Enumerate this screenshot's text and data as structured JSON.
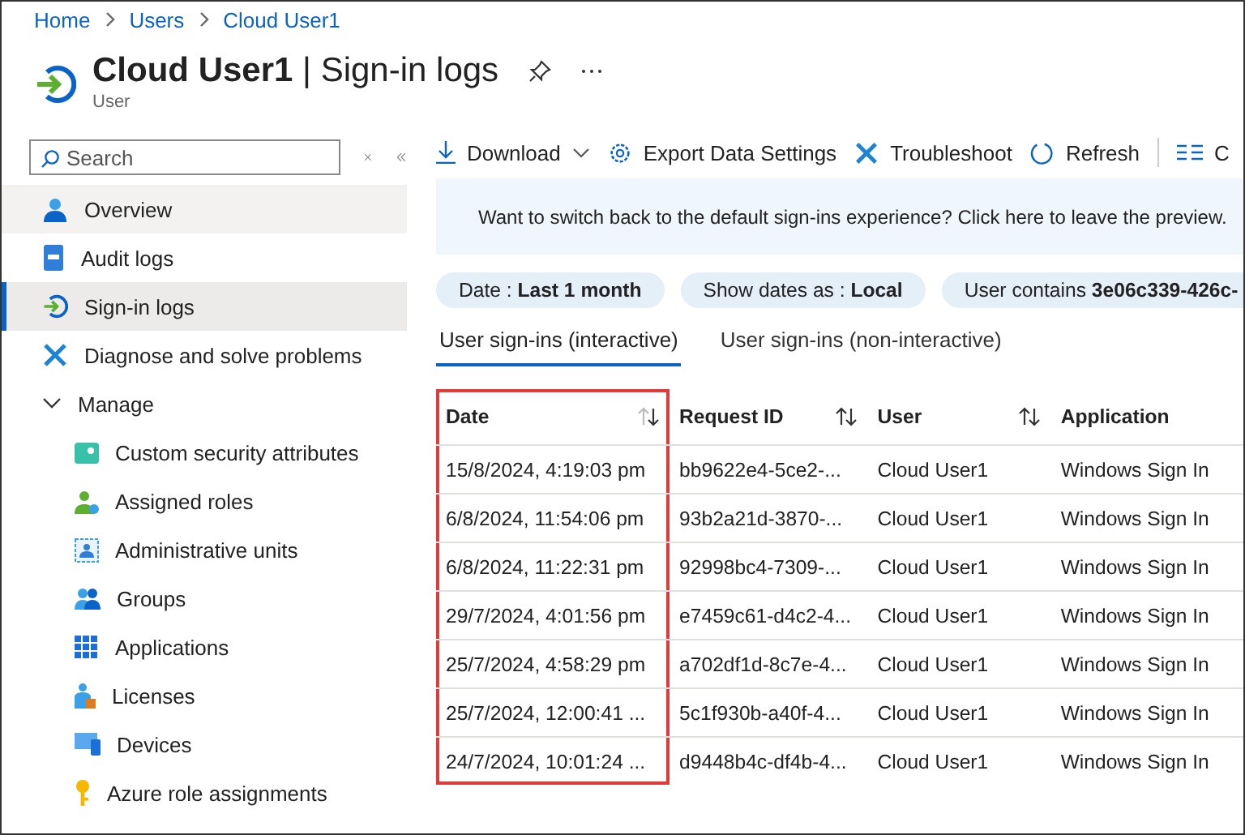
{
  "breadcrumb": [
    "Home",
    "Users",
    "Cloud User1"
  ],
  "header": {
    "title": "Cloud User1",
    "separator": "|",
    "section": "Sign-in logs",
    "subtitle": "User"
  },
  "sidebar": {
    "search": {
      "placeholder": "Search"
    },
    "items": [
      {
        "label": "Overview",
        "selected": false,
        "hovered": true
      },
      {
        "label": "Audit logs",
        "selected": false,
        "hovered": false
      },
      {
        "label": "Sign-in logs",
        "selected": true,
        "hovered": false
      },
      {
        "label": "Diagnose and solve problems",
        "selected": false,
        "hovered": false
      },
      {
        "label": "Manage",
        "selected": false,
        "hovered": false,
        "expanded": true,
        "children": [
          {
            "label": "Custom security attributes",
            "selected": false
          },
          {
            "label": "Assigned roles",
            "selected": false
          },
          {
            "label": "Administrative units",
            "selected": false
          },
          {
            "label": "Groups",
            "selected": false
          },
          {
            "label": "Applications",
            "selected": false
          },
          {
            "label": "Licenses",
            "selected": false
          },
          {
            "label": "Devices",
            "selected": false
          },
          {
            "label": "Azure role assignments",
            "selected": false
          }
        ]
      }
    ]
  },
  "toolbar": [
    {
      "label": "Download",
      "dropdown": true
    },
    {
      "label": "Export Data Settings",
      "dropdown": false
    },
    {
      "label": "Troubleshoot",
      "dropdown": false
    },
    {
      "label": "Refresh",
      "dropdown": false
    },
    {
      "label": "C",
      "dropdown": false
    }
  ],
  "banner": "Want to switch back to the default sign-ins experience? Click here to leave the preview.",
  "filters": [
    {
      "label": "Date : ",
      "value": "Last 1 month"
    },
    {
      "label": "Show dates as : ",
      "value": "Local"
    },
    {
      "label": "User contains ",
      "value": "3e06c339-426c-"
    }
  ],
  "tabs": [
    {
      "label": "User sign-ins (interactive)",
      "selected": true
    },
    {
      "label": "User sign-ins (non-interactive)",
      "selected": false
    }
  ],
  "table": {
    "columns": [
      {
        "label": "Date",
        "sorted": true,
        "highlighted": true
      },
      {
        "label": "Request ID",
        "sorted": false,
        "highlighted": false
      },
      {
        "label": "User",
        "sorted": false,
        "highlighted": false
      },
      {
        "label": "Application",
        "highlighted": false
      }
    ],
    "rows": [
      [
        "15/8/2024, 4:19:03 pm",
        "bb9622e4-5ce2-...",
        "Cloud User1",
        "Windows Sign In"
      ],
      [
        "6/8/2024, 11:54:06 pm",
        "93b2a21d-3870-...",
        "Cloud User1",
        "Windows Sign In"
      ],
      [
        "6/8/2024, 11:22:31 pm",
        "92998bc4-7309-...",
        "Cloud User1",
        "Windows Sign In"
      ],
      [
        "29/7/2024, 4:01:56 pm",
        "e7459c61-d4c2-4...",
        "Cloud User1",
        "Windows Sign In"
      ],
      [
        "25/7/2024, 4:58:29 pm",
        "a702df1d-8c7e-4...",
        "Cloud User1",
        "Windows Sign In"
      ],
      [
        "25/7/2024, 12:00:41 ...",
        "5c1f930b-a40f-4...",
        "Cloud User1",
        "Windows Sign In"
      ],
      [
        "24/7/2024, 10:01:24 ...",
        "d9448b4c-df4b-4...",
        "Cloud User1",
        "Windows Sign In"
      ]
    ]
  }
}
